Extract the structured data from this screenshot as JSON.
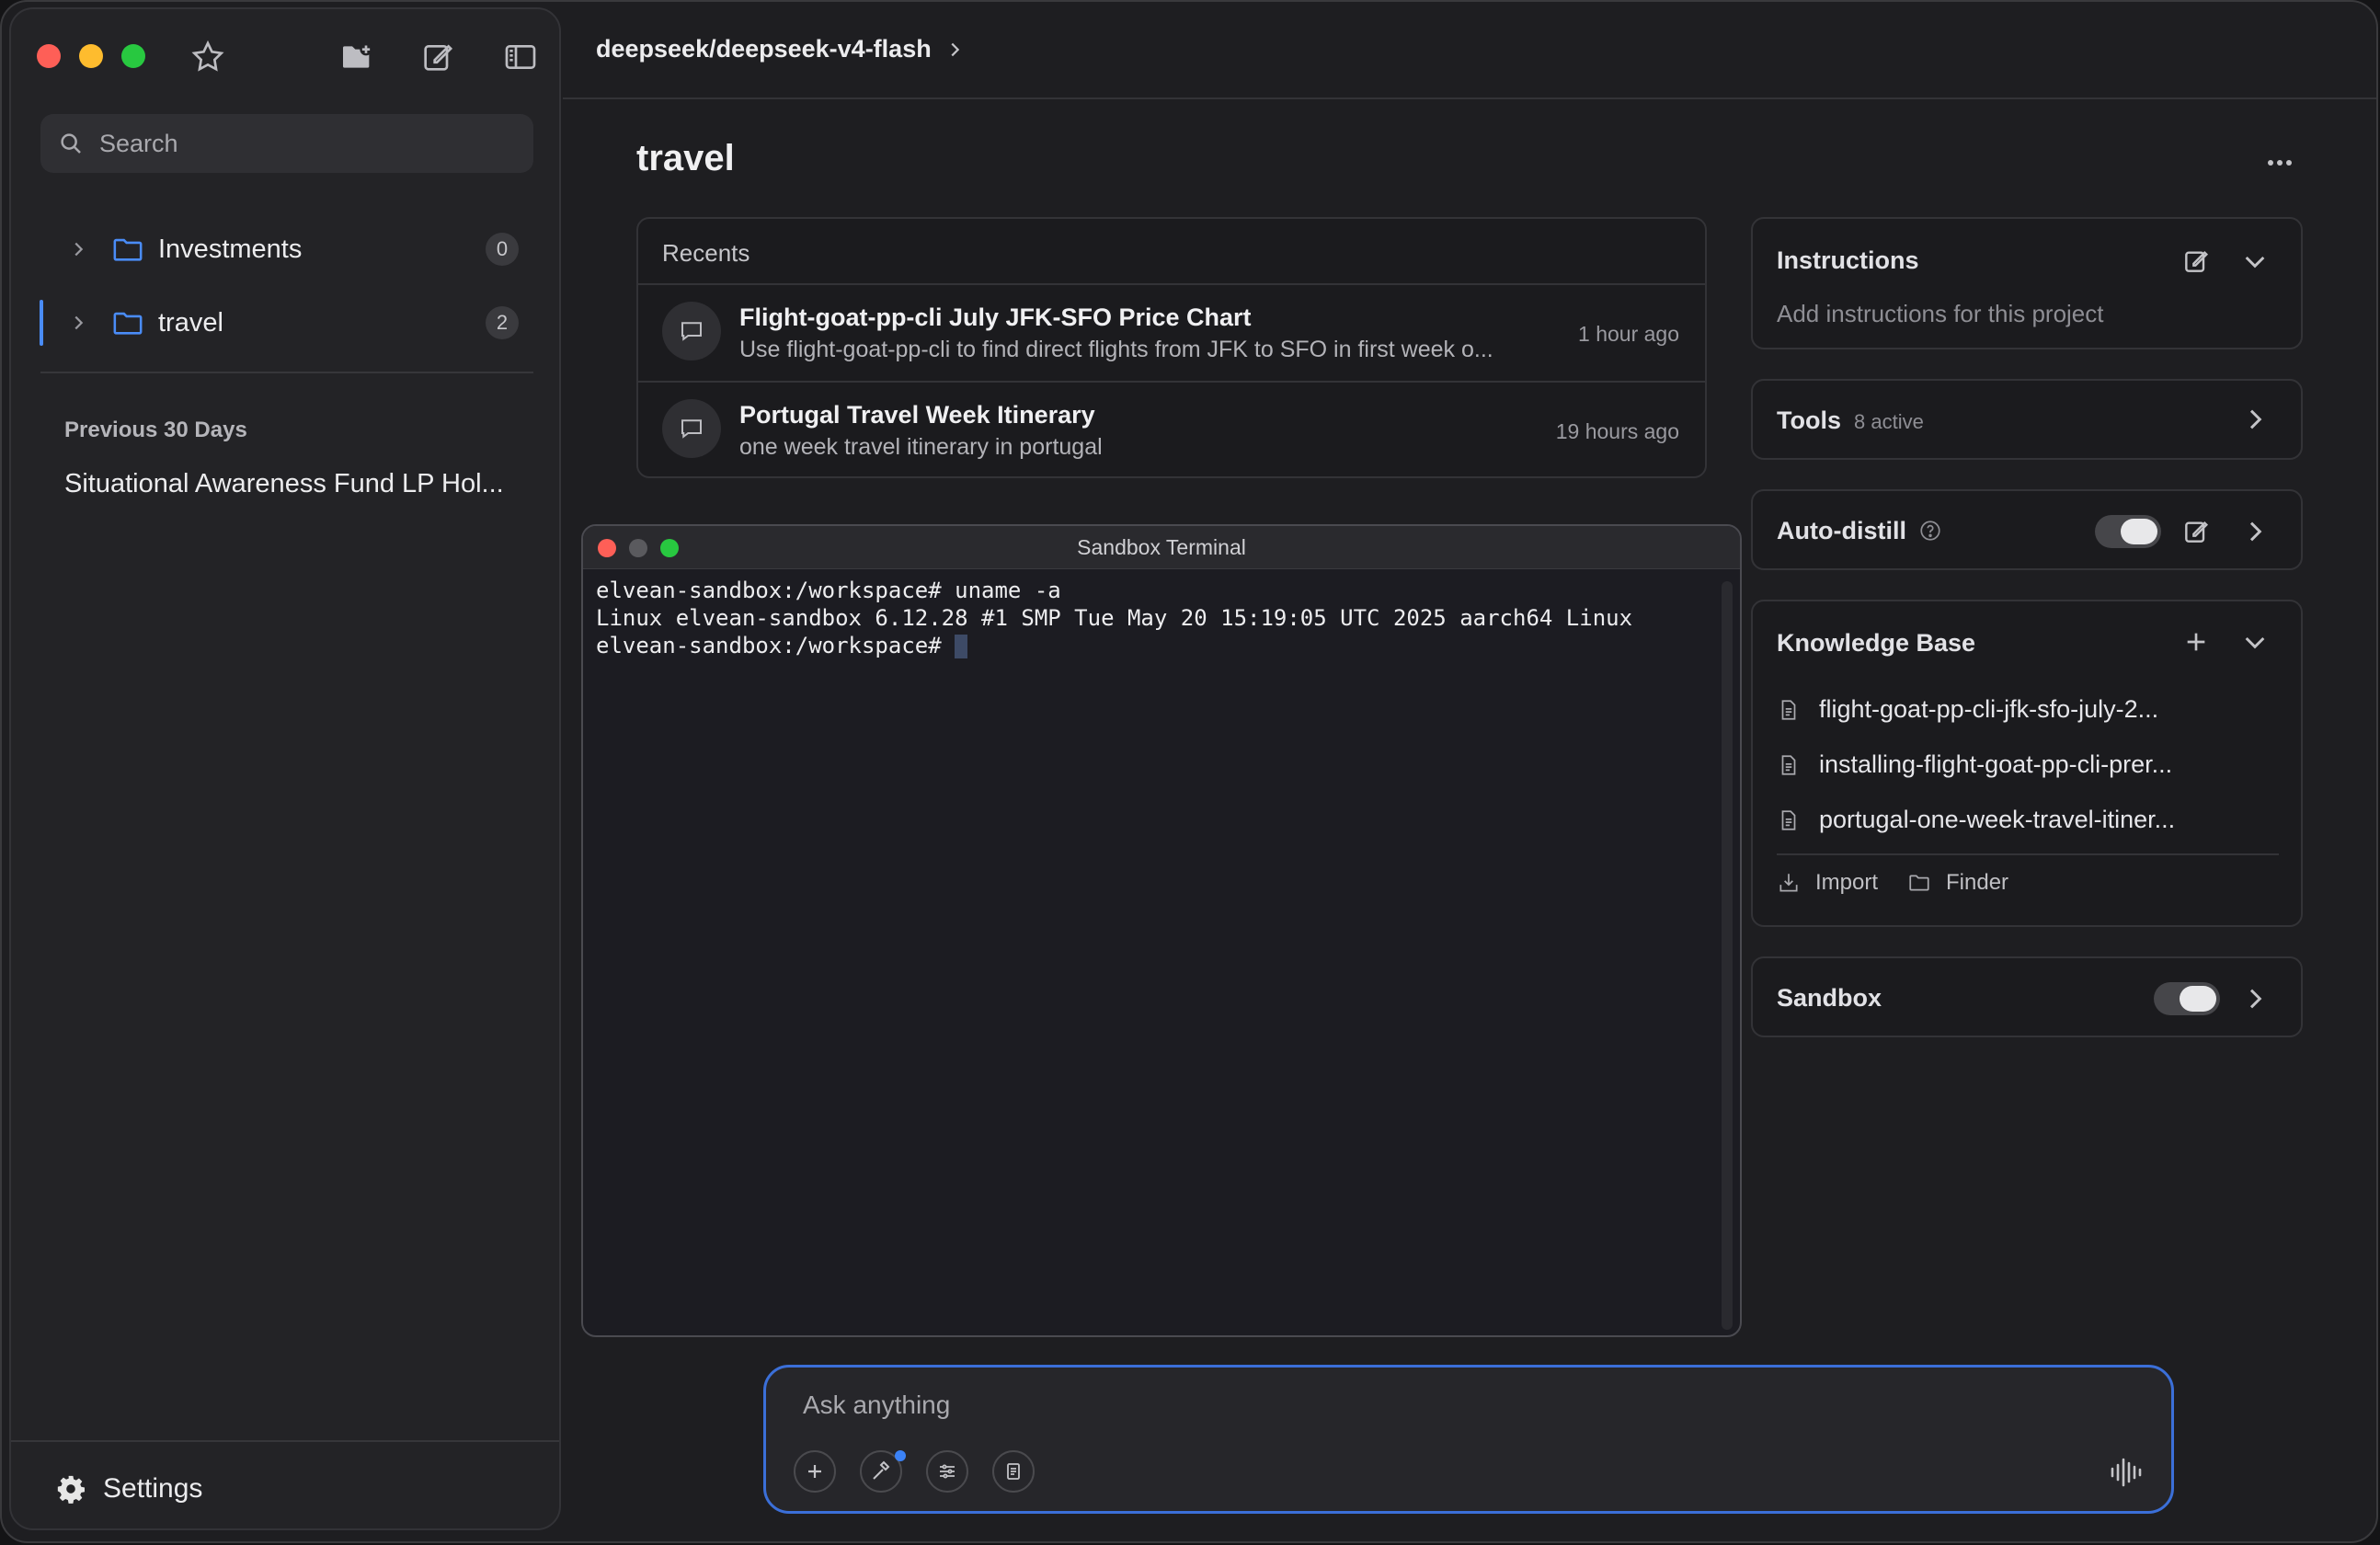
{
  "sidebar": {
    "search_placeholder": "Search",
    "folders": [
      {
        "label": "Investments",
        "count": "0"
      },
      {
        "label": "travel",
        "count": "2"
      }
    ],
    "section_title": "Previous 30 Days",
    "previous_items": [
      "Situational Awareness Fund LP Hol..."
    ],
    "settings_label": "Settings"
  },
  "header": {
    "model": "deepseek/deepseek-v4-flash"
  },
  "project": {
    "title": "travel"
  },
  "recents": {
    "title": "Recents",
    "items": [
      {
        "title": "Flight-goat-pp-cli July JFK-SFO Price Chart",
        "subtitle": "Use flight-goat-pp-cli to find direct flights from JFK to SFO in first week o...",
        "time": "1 hour ago"
      },
      {
        "title": "Portugal Travel Week Itinerary",
        "subtitle": "one week travel itinerary in portugal",
        "time": "19 hours ago"
      }
    ]
  },
  "terminal": {
    "title": "Sandbox Terminal",
    "lines": [
      "elvean-sandbox:/workspace# uname -a",
      "Linux elvean-sandbox 6.12.28 #1 SMP Tue May 20 15:19:05 UTC 2025 aarch64 Linux",
      "elvean-sandbox:/workspace# "
    ]
  },
  "panels": {
    "instructions": {
      "title": "Instructions",
      "placeholder": "Add instructions for this project"
    },
    "tools": {
      "title": "Tools",
      "status": "8 active"
    },
    "auto_distill": {
      "title": "Auto-distill",
      "enabled": true
    },
    "knowledge_base": {
      "title": "Knowledge Base",
      "files": [
        "flight-goat-pp-cli-jfk-sfo-july-2...",
        "installing-flight-goat-pp-cli-prer...",
        "portugal-one-week-travel-itiner..."
      ],
      "import_label": "Import",
      "finder_label": "Finder"
    },
    "sandbox": {
      "title": "Sandbox",
      "enabled": true
    }
  },
  "composer": {
    "placeholder": "Ask anything"
  },
  "colors": {
    "accent": "#4a8cf7",
    "composer_border": "#3b6fd8",
    "background": "#1e1e21"
  }
}
